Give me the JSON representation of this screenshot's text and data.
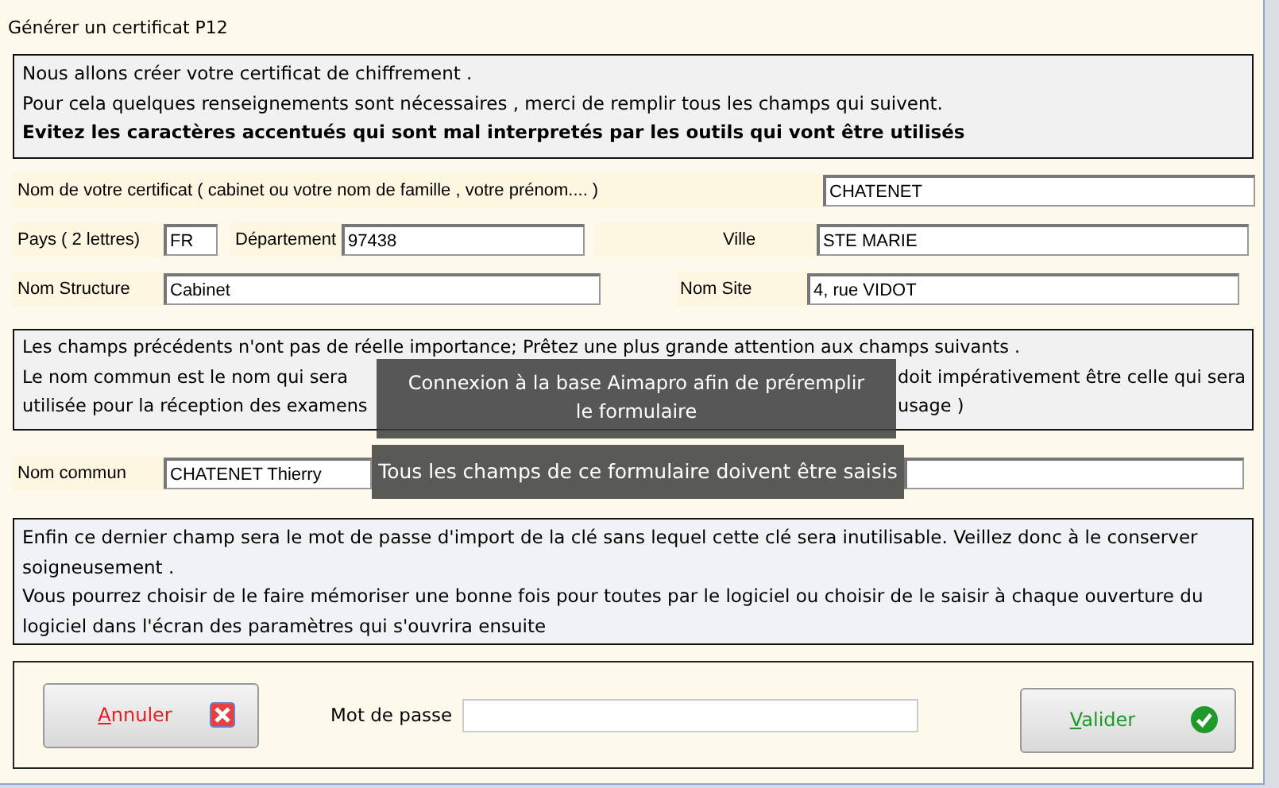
{
  "window": {
    "title": "Générer un certificat P12"
  },
  "intro": {
    "lines": [
      {
        "text": "Nous allons créer votre certificat de chiffrement .",
        "bold": false
      },
      {
        "text": "Pour cela quelques renseignements sont nécessaires , merci de remplir tous les champs qui suivent.",
        "bold": false
      },
      {
        "text": "Evitez les caractères accentués qui sont mal interpretés par les outils qui vont être utilisés",
        "bold": true
      }
    ]
  },
  "fields": {
    "certificate_name": {
      "label": "Nom de votre certificat ( cabinet ou votre nom de famille , votre prénom.... )",
      "value": "CHATENET"
    },
    "country": {
      "label": "Pays ( 2 lettres)",
      "value": "FR"
    },
    "department": {
      "label": "Département",
      "value": "97438"
    },
    "city": {
      "label": "Ville",
      "value": "STE MARIE"
    },
    "structure": {
      "label": "Nom Structure",
      "value": "Cabinet"
    },
    "site": {
      "label": "Nom Site",
      "value": "4, rue VIDOT"
    }
  },
  "notice": {
    "lines": [
      [
        "Les champs précédents n'ont pas de réelle importance; Prêtez une plus grande attention aux champs suivants ."
      ],
      [
        "Le nom commun est le nom qui sera",
        "doit impérativement être celle qui sera"
      ],
      [
        "utilisée pour la réception des examens",
        "usage )"
      ]
    ]
  },
  "common": {
    "common_name": {
      "label": "Nom commun",
      "value": "CHATENET Thierry"
    }
  },
  "password_notice": {
    "text": "Enfin ce dernier champ sera le mot de passe d'import de la clé sans lequel cette clé sera inutilisable. Veillez donc à le conserver soigneusement .\nVous pourrez choisir de le faire mémoriser une bonne fois pour toutes par le logiciel ou choisir de le saisir à chaque ouverture du logiciel dans l'écran des paramètres qui s'ouvrira ensuite"
  },
  "footer": {
    "cancel": "Annuler",
    "password_label": "Mot de passe",
    "validate": "Valider"
  },
  "toasts": [
    "Connexion à la base Aimapro afin de préremplir le formulaire",
    "Tous les champs de ce formulaire doivent être saisis"
  ]
}
